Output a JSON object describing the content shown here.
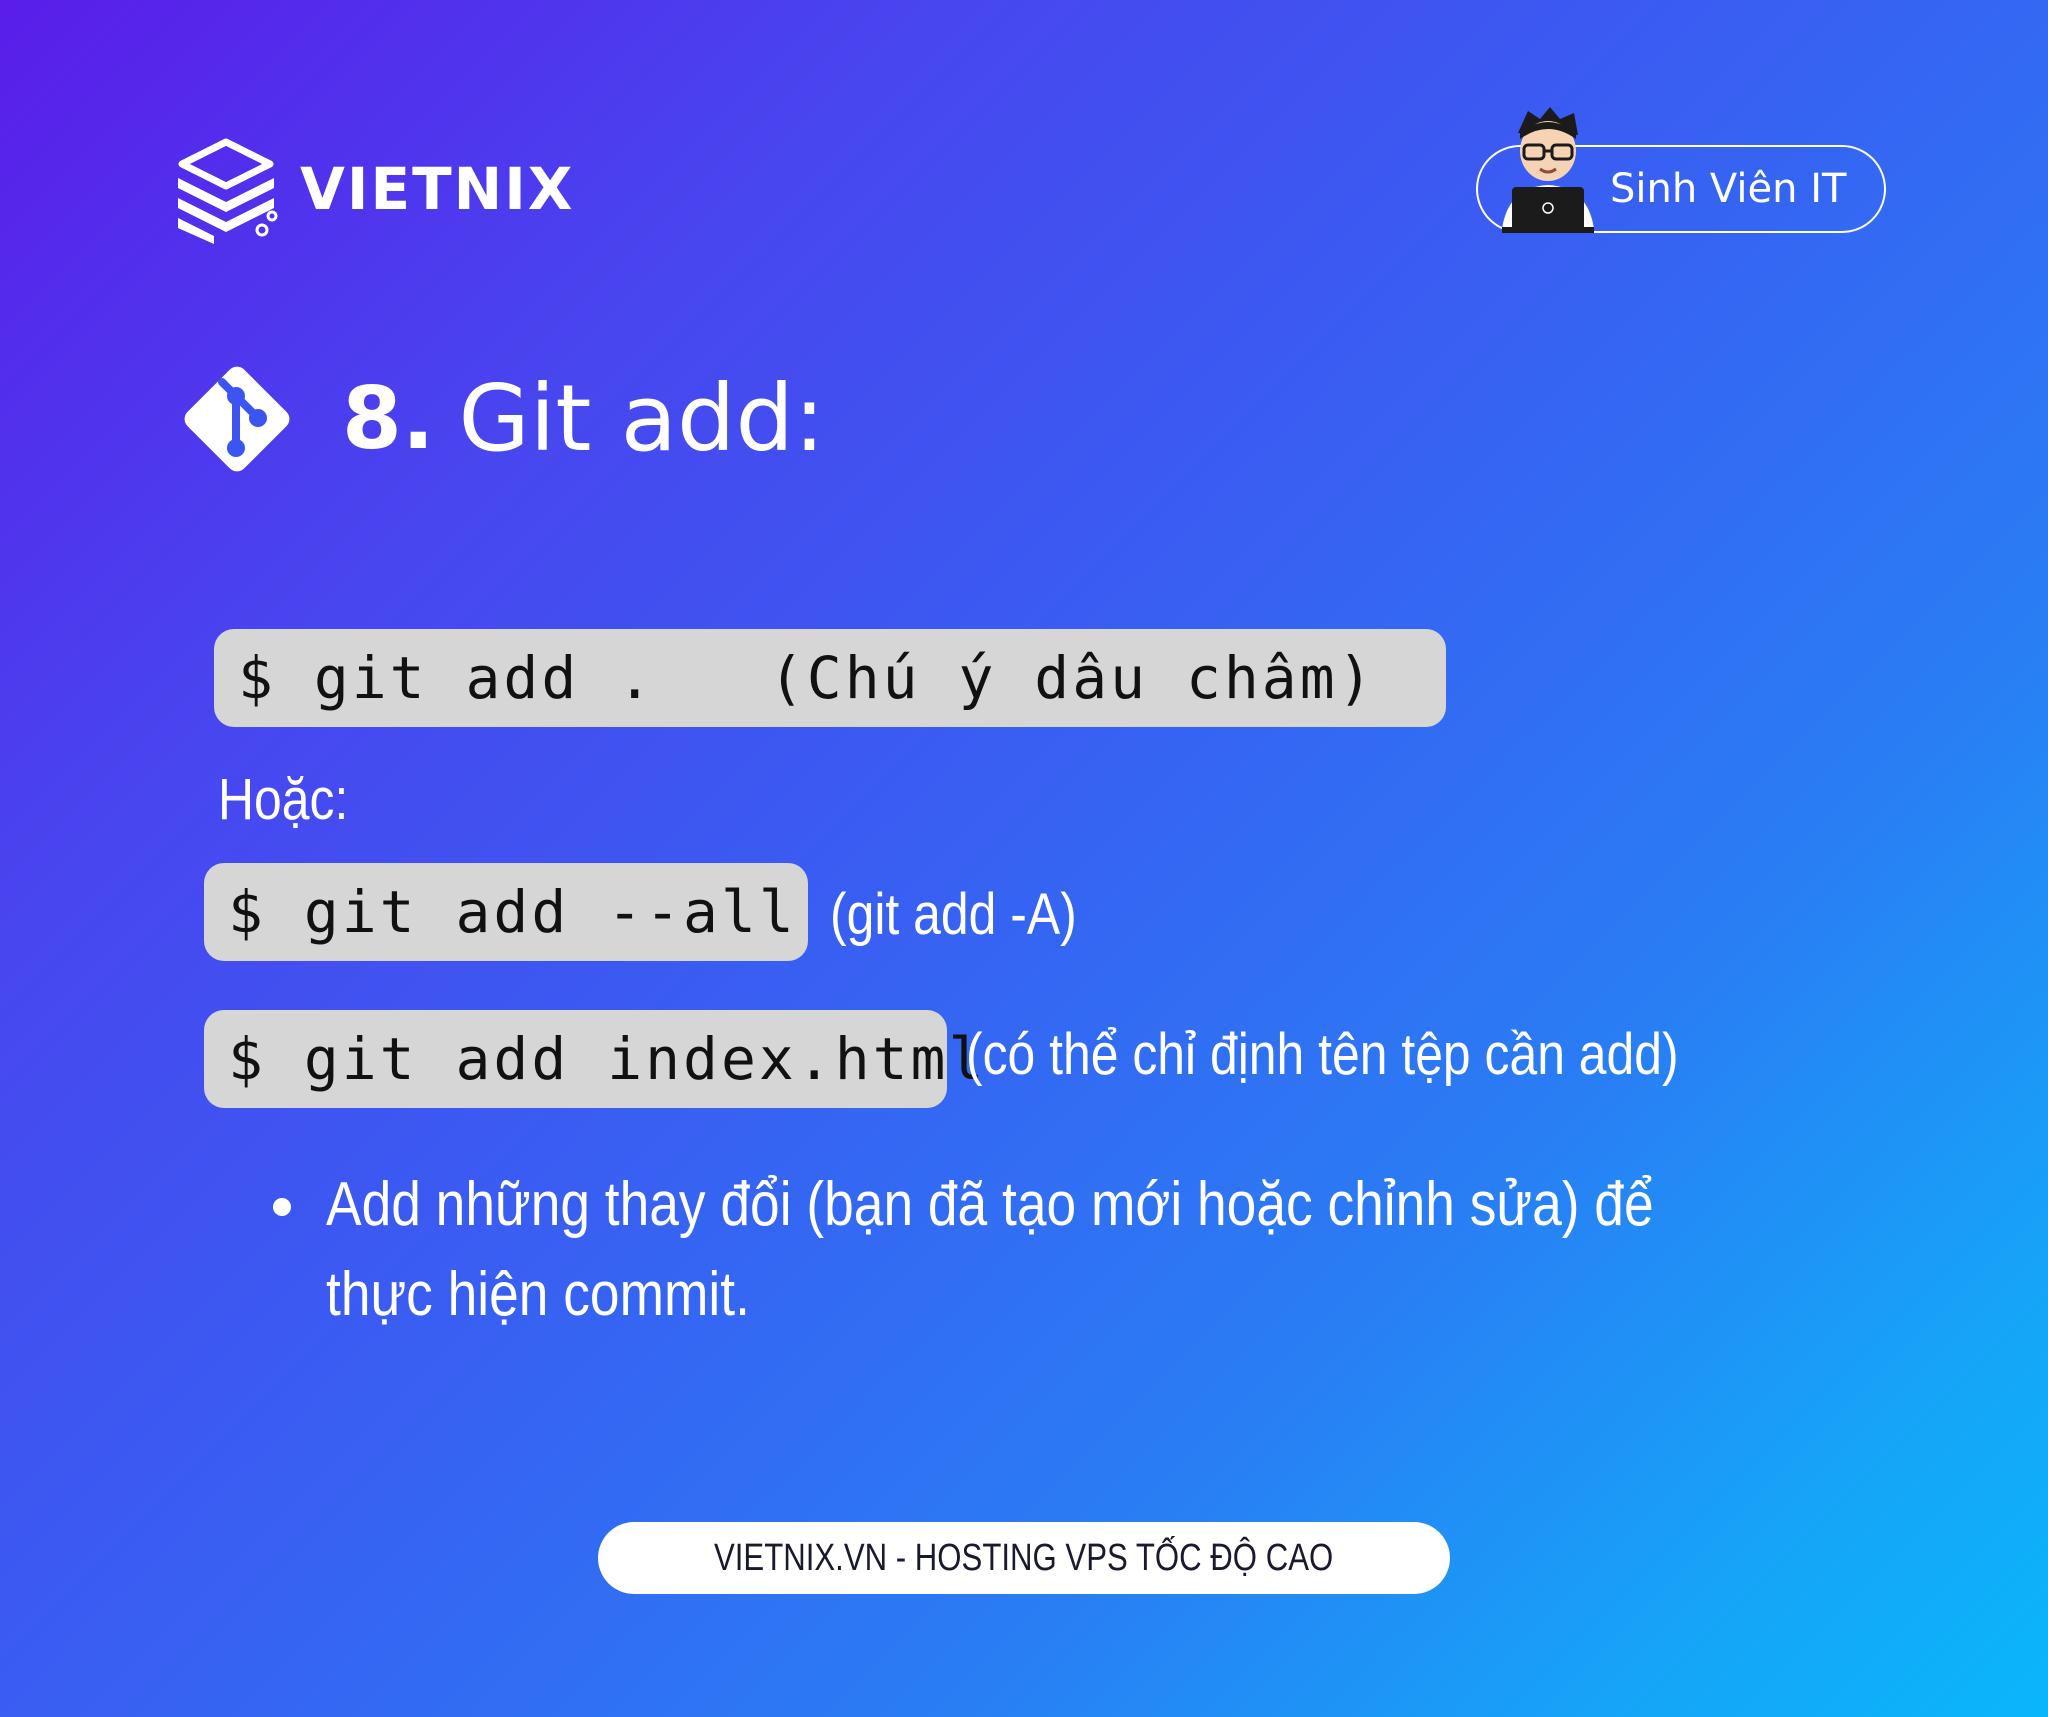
{
  "brand": {
    "name": "VIETNIX",
    "icon": "stacked-layers-logo"
  },
  "badge": {
    "label": "Sinh Viên IT",
    "icon": "student-avatar-with-laptop"
  },
  "heading": {
    "number": "8.",
    "title": "Git add:",
    "icon": "git-logo-icon"
  },
  "commands": [
    {
      "code": "$ git add .   (Chú ý dâu châm)"
    },
    {
      "code": "$ git add --all",
      "note": "(git add -A)"
    },
    {
      "code": "$ git add index.html",
      "note": "(có thể chỉ định tên tệp cần add)"
    }
  ],
  "alt_label": "Hoặc:",
  "bullets": [
    "Add những thay đổi (bạn đã tạo mới hoặc chỉnh sửa) để thực hiện commit."
  ],
  "footer": {
    "text": "VIETNIX.VN - HOSTING VPS TỐC ĐỘ CAO"
  },
  "colors": {
    "bg_start": "#5a1dea",
    "bg_end": "#0ab6fb",
    "code_bg": "#d6d6d6"
  }
}
